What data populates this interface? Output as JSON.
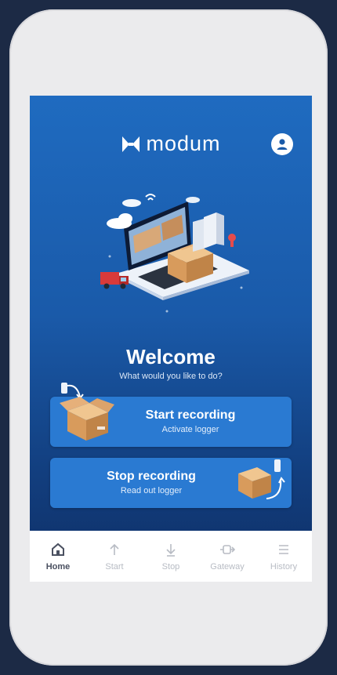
{
  "header": {
    "logo_text": "modum",
    "profile_icon": "person-icon"
  },
  "welcome": {
    "title": "Welcome",
    "subtitle": "What would you like to do?"
  },
  "actions": {
    "start": {
      "label": "Start recording",
      "sublabel": "Activate logger",
      "icon": "box-logger-icon"
    },
    "stop": {
      "label": "Stop recording",
      "sublabel": "Read out logger",
      "icon": "box-logger-icon"
    }
  },
  "nav": {
    "items": [
      {
        "label": "Home",
        "icon": "home-icon",
        "active": true
      },
      {
        "label": "Start",
        "icon": "arrow-up-icon",
        "active": false
      },
      {
        "label": "Stop",
        "icon": "arrow-down-icon",
        "active": false
      },
      {
        "label": "Gateway",
        "icon": "gateway-icon",
        "active": false
      },
      {
        "label": "History",
        "icon": "list-icon",
        "active": false
      }
    ]
  },
  "colors": {
    "accent": "#2a7ad2",
    "screen_top": "#1f6bc0",
    "screen_bottom": "#0f2f66",
    "nav_inactive": "#b8bcc4",
    "nav_active": "#4a5060"
  }
}
